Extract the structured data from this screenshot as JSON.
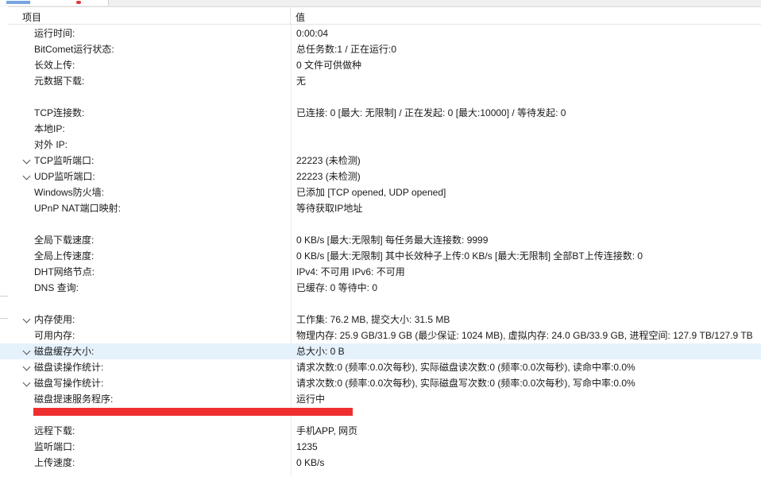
{
  "header": {
    "item": "项目",
    "value": "值"
  },
  "rows": [
    {
      "label": "运行时间:",
      "value": "0:00:04",
      "chevron": false
    },
    {
      "label": "BitComet运行状态:",
      "value": "总任务数:1 / 正在运行:0",
      "chevron": false
    },
    {
      "label": "长效上传:",
      "value": "0 文件可供做种",
      "chevron": false
    },
    {
      "label": "元数据下载:",
      "value": "无",
      "chevron": false
    },
    {
      "spacer": true
    },
    {
      "label": "TCP连接数:",
      "value": "已连接: 0 [最大: 无限制] / 正在发起: 0 [最大:10000] / 等待发起: 0",
      "chevron": false
    },
    {
      "label": "本地IP:",
      "value": "",
      "chevron": false
    },
    {
      "label": "对外 IP:",
      "value": "",
      "chevron": false
    },
    {
      "label": "TCP监听端口:",
      "value": "22223 (未检测)",
      "chevron": true
    },
    {
      "label": "UDP监听端口:",
      "value": "22223 (未检测)",
      "chevron": true
    },
    {
      "label": "Windows防火墙:",
      "value": "已添加 [TCP opened, UDP opened]",
      "chevron": false
    },
    {
      "label": "UPnP NAT端口映射:",
      "value": "等待获取IP地址",
      "chevron": false
    },
    {
      "spacer": true
    },
    {
      "label": "全局下载速度:",
      "value": "0 KB/s [最大:无限制]      每任务最大连接数: 9999",
      "chevron": false
    },
    {
      "label": "全局上传速度:",
      "value": "0 KB/s [最大:无限制]      其中长效种子上传:0 KB/s [最大:无限制]      全部BT上传连接数: 0",
      "chevron": false
    },
    {
      "label": "DHT网络节点:",
      "value": "IPv4: 不可用  IPv6: 不可用",
      "chevron": false
    },
    {
      "label": "DNS 查询:",
      "value": "已缓存:  0   等待中:  0",
      "chevron": false
    },
    {
      "spacer": true
    },
    {
      "label": "内存使用:",
      "value": "工作集: 76.2 MB, 提交大小: 31.5 MB",
      "chevron": true
    },
    {
      "label": "可用内存:",
      "value": "物理内存: 25.9 GB/31.9 GB (最少保证: 1024 MB), 虚拟内存: 24.0 GB/33.9 GB, 进程空间: 127.9 TB/127.9 TB",
      "chevron": false
    },
    {
      "label": "磁盘缓存大小:",
      "value": "总大小:  0 B",
      "chevron": true,
      "selected": true
    },
    {
      "label": "磁盘读操作统计:",
      "value": "请求次数:0 (频率:0.0次每秒), 实际磁盘读次数:0 (频率:0.0次每秒), 读命中率:0.0%",
      "chevron": true
    },
    {
      "label": "磁盘写操作统计:",
      "value": "请求次数:0 (频率:0.0次每秒), 实际磁盘写次数:0 (频率:0.0次每秒), 写命中率:0.0%",
      "chevron": true
    },
    {
      "label": "磁盘提速服务程序:",
      "value": "运行中",
      "chevron": false
    },
    {
      "spacer": true
    },
    {
      "label": "远程下载:",
      "value": "手机APP, 网页",
      "chevron": false
    },
    {
      "label": "监听端口:",
      "value": "1235",
      "chevron": false
    },
    {
      "label": "上传速度:",
      "value": "0 KB/s",
      "chevron": false
    }
  ]
}
